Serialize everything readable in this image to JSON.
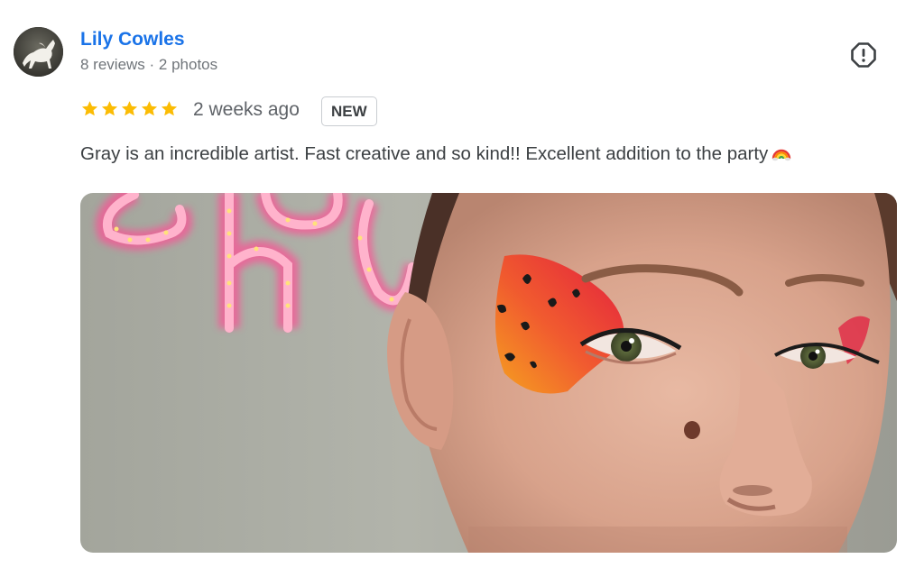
{
  "reviewer": {
    "name": "Lily Cowles",
    "meta": "8 reviews · 2 photos",
    "avatar_icon": "white-horse-avatar"
  },
  "review": {
    "rating": 5,
    "rating_max": 5,
    "time_ago": "2 weeks ago",
    "badge": "NEW",
    "text": "Gray is an incredible artist. Fast creative and so kind!! Excellent addition to the party",
    "emoji_icon": "rainbow-emoji-icon"
  },
  "actions": {
    "report_icon": "report-exclamation-icon"
  },
  "photo": {
    "subject": "face-paint-photo"
  },
  "colors": {
    "name_link": "#1a73e8",
    "star": "#fbbc04",
    "meta_text": "#70757a",
    "body_text": "#3c4043"
  }
}
